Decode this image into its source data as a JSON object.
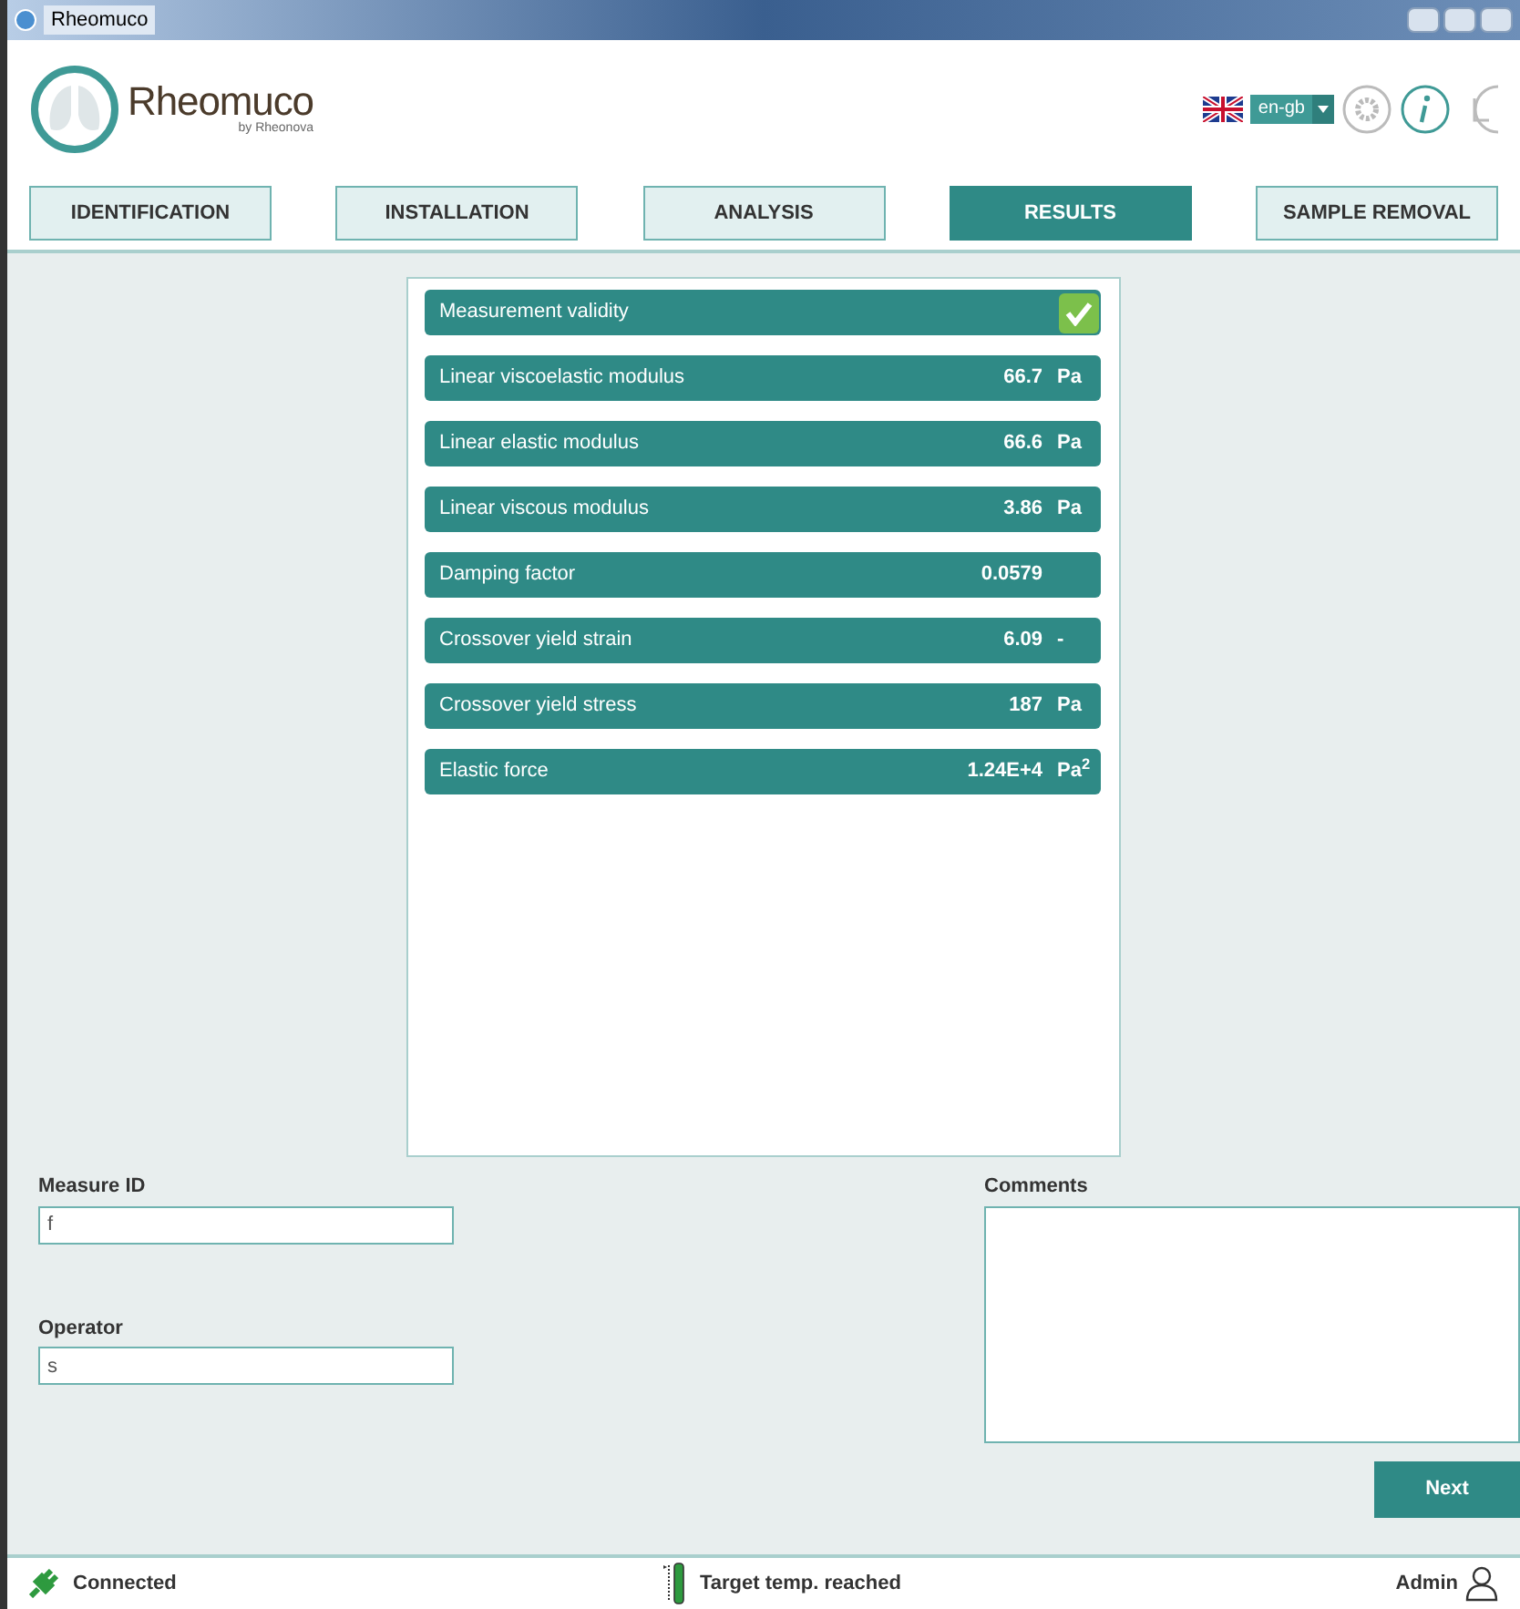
{
  "window": {
    "title": "Rheomuco"
  },
  "header": {
    "logo_text": "Rheomuco",
    "logo_subtext": "by Rheonova",
    "language": "en-gb"
  },
  "tabs": [
    {
      "label": "IDENTIFICATION",
      "selected": false
    },
    {
      "label": "INSTALLATION",
      "selected": false
    },
    {
      "label": "ANALYSIS",
      "selected": false
    },
    {
      "label": "RESULTS",
      "selected": true
    },
    {
      "label": "SAMPLE REMOVAL",
      "selected": false
    }
  ],
  "results": [
    {
      "kind": "check",
      "label": "Measurement validity",
      "valid": true
    },
    {
      "kind": "value",
      "label": "Linear viscoelastic modulus",
      "value": "66.7",
      "unit": "Pa"
    },
    {
      "kind": "value",
      "label": "Linear elastic modulus",
      "value": "66.6",
      "unit": "Pa"
    },
    {
      "kind": "value",
      "label": "Linear viscous modulus",
      "value": "3.86",
      "unit": "Pa"
    },
    {
      "kind": "value",
      "label": "Damping factor",
      "value": "0.0579"
    },
    {
      "kind": "value",
      "label": "Crossover yield strain",
      "value": "6.09",
      "unit": "-"
    },
    {
      "kind": "value",
      "label": "Crossover yield stress",
      "value": "187",
      "unit": "Pa"
    },
    {
      "kind": "value",
      "label": "Elastic force",
      "value": "1.24E+4",
      "unit": "Pa$^{2}$"
    }
  ],
  "form": {
    "measure_id": {
      "label": "Measure ID",
      "value": "f"
    },
    "operator": {
      "label": "Operator",
      "value": "s"
    },
    "comments": {
      "label": "Comments"
    }
  },
  "next_button": "Next",
  "status_bar": {
    "connection": "Connected",
    "temperature": "Target temp. reached",
    "user": "Admin"
  }
}
